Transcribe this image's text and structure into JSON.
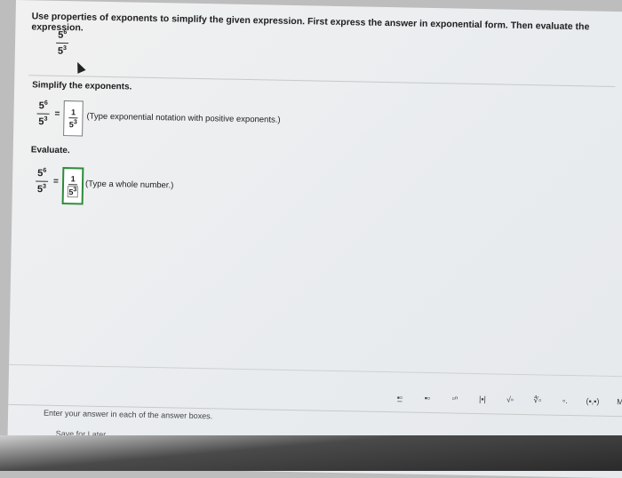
{
  "question": {
    "instruction": "Use properties of exponents to simplify the given expression. First express the answer in exponential form. Then evaluate the expression.",
    "expression": {
      "num_base": "5",
      "num_exp": "6",
      "den_base": "5",
      "den_exp": "3"
    }
  },
  "step1": {
    "label": "Simplify the exponents.",
    "equals": "=",
    "answer": {
      "num": "1",
      "den_base": "5",
      "den_exp": "3"
    },
    "hint": "(Type exponential notation with positive exponents.)"
  },
  "step2": {
    "label": "Evaluate.",
    "equals": "=",
    "answer": {
      "num": "1",
      "den_base": "5",
      "den_exp": "3"
    },
    "hint": "(Type a whole number.)"
  },
  "toolbar": {
    "buttons": [
      {
        "icon": "fraction-icon",
        "glyph": "▪̲▫"
      },
      {
        "icon": "mixed-number-icon",
        "glyph": "▪▫"
      },
      {
        "icon": "exponent-icon",
        "glyph": "▫ⁿ"
      },
      {
        "icon": "absolute-value-icon",
        "glyph": "|▪|"
      },
      {
        "icon": "square-root-icon",
        "glyph": "√▫"
      },
      {
        "icon": "nth-root-icon",
        "glyph": "∜▫"
      },
      {
        "icon": "decimal-icon",
        "glyph": "▫."
      },
      {
        "icon": "ordered-pair-icon",
        "glyph": "(▪,▪)"
      },
      {
        "icon": "more-icon",
        "glyph": "M"
      }
    ]
  },
  "footer": {
    "instruction": "Enter your answer in each of the answer boxes.",
    "save_label": "Save for Later"
  }
}
